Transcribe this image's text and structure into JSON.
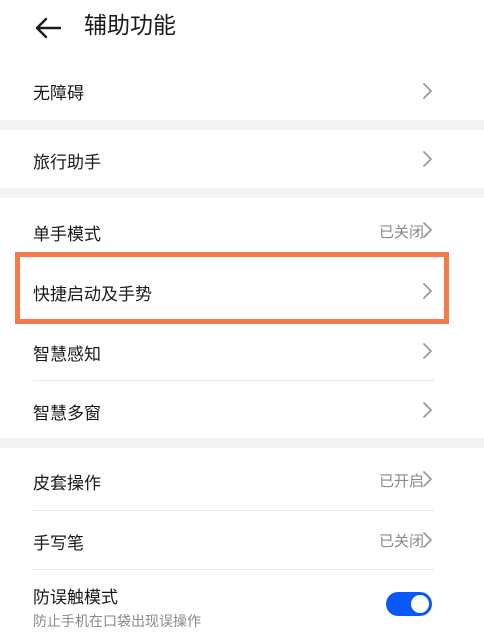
{
  "header": {
    "title": "辅助功能",
    "back_icon": "arrow-left-icon"
  },
  "rows": {
    "accessibility": {
      "label": "无障碍"
    },
    "travel_assistant": {
      "label": "旅行助手"
    },
    "one_hand_mode": {
      "label": "单手模式",
      "status": "已关闭"
    },
    "shortcuts_gestures": {
      "label": "快捷启动及手势"
    },
    "smart_perception": {
      "label": "智慧感知"
    },
    "smart_multiwindow": {
      "label": "智慧多窗"
    },
    "cover_operation": {
      "label": "皮套操作",
      "status": "已开启"
    },
    "stylus": {
      "label": "手写笔",
      "status": "已关闭"
    },
    "accidental_touch": {
      "label": "防误触模式",
      "description": "防止手机在口袋出现误操作",
      "toggle_on": true
    }
  },
  "colors": {
    "highlight": "#f57a4a",
    "toggle_on": "#0a59f7",
    "secondary_text": "#8a8a8a"
  }
}
